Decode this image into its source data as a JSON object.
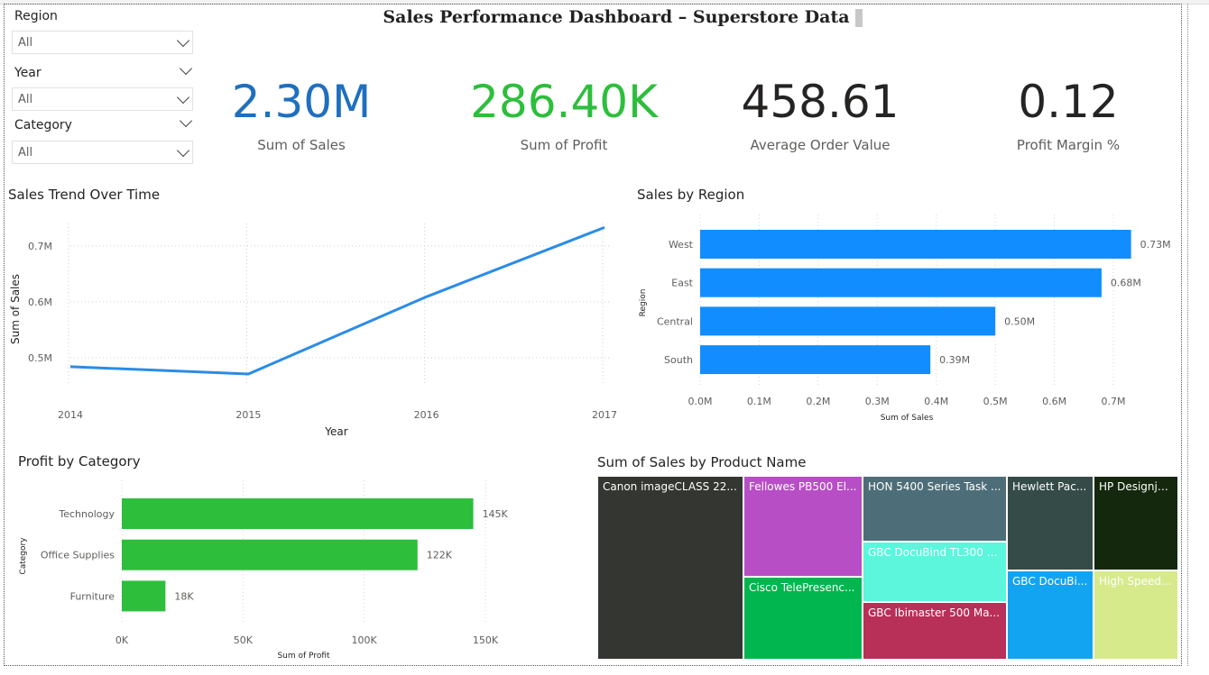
{
  "title": "Sales Performance Dashboard – Superstore Data",
  "filters": [
    {
      "label": "Region",
      "value": "All"
    },
    {
      "label": "Year",
      "value": "All"
    },
    {
      "label": "Category",
      "value": "All"
    }
  ],
  "kpis": [
    {
      "value": "2.30M",
      "label": "Sum of Sales",
      "color": "#1F6FBF"
    },
    {
      "value": "286.40K",
      "label": "Sum of Profit",
      "color": "#2DBE3C"
    },
    {
      "value": "458.61",
      "label": "Average Order Value",
      "color": "#252423"
    },
    {
      "value": "0.12",
      "label": "Profit Margin %",
      "color": "#252423"
    }
  ],
  "chart_data": [
    {
      "type": "line",
      "title": "Sales Trend Over Time",
      "xlabel": "Year",
      "ylabel": "Sum of Sales",
      "x": [
        "2014",
        "2015",
        "2016",
        "2017"
      ],
      "values": [
        0.484,
        0.471,
        0.609,
        0.733
      ],
      "yticks": [
        "0.5M",
        "0.6M",
        "0.7M"
      ],
      "ylim": [
        0.45,
        0.74
      ],
      "color": "#2B8CE6"
    },
    {
      "type": "bar",
      "orientation": "horizontal",
      "title": "Sales by Region",
      "xlabel": "Sum of Sales",
      "ylabel": "Region",
      "categories": [
        "West",
        "East",
        "Central",
        "South"
      ],
      "values": [
        0.73,
        0.68,
        0.5,
        0.39
      ],
      "data_labels": [
        "0.73M",
        "0.68M",
        "0.50M",
        "0.39M"
      ],
      "xticks": [
        "0.0M",
        "0.1M",
        "0.2M",
        "0.3M",
        "0.4M",
        "0.5M",
        "0.6M",
        "0.7M"
      ],
      "xlim": [
        0,
        0.7
      ],
      "color": "#118DFF"
    },
    {
      "type": "bar",
      "orientation": "horizontal",
      "title": "Profit by Category",
      "xlabel": "Sum of Profit",
      "ylabel": "Category",
      "categories": [
        "Technology",
        "Office Supplies",
        "Furniture"
      ],
      "values": [
        145,
        122,
        18
      ],
      "data_labels": [
        "145K",
        "122K",
        "18K"
      ],
      "xticks": [
        "0K",
        "50K",
        "100K",
        "150K"
      ],
      "xlim": [
        0,
        150
      ],
      "color": "#2DBE3C"
    },
    {
      "type": "treemap",
      "title": "Sum of Sales by Product Name",
      "items": [
        {
          "label": "Canon imageCLASS 22...",
          "color": "#333631"
        },
        {
          "label": "Fellowes PB500 El...",
          "color": "#B84EC6"
        },
        {
          "label": "Cisco TelePresenc...",
          "color": "#01B64E"
        },
        {
          "label": "HON 5400 Series Task ...",
          "color": "#4D6E78"
        },
        {
          "label": "GBC DocuBind TL300 E...",
          "color": "#5CF6DD"
        },
        {
          "label": "GBC Ibimaster 500 Ma...",
          "color": "#B82F57"
        },
        {
          "label": "Hewlett Pac...",
          "color": "#354B47"
        },
        {
          "label": "GBC DocuBi...",
          "color": "#12A4F0"
        },
        {
          "label": "HP Designje...",
          "color": "#14280D"
        },
        {
          "label": "High Speed...",
          "color": "#D6EA8C"
        }
      ]
    }
  ]
}
